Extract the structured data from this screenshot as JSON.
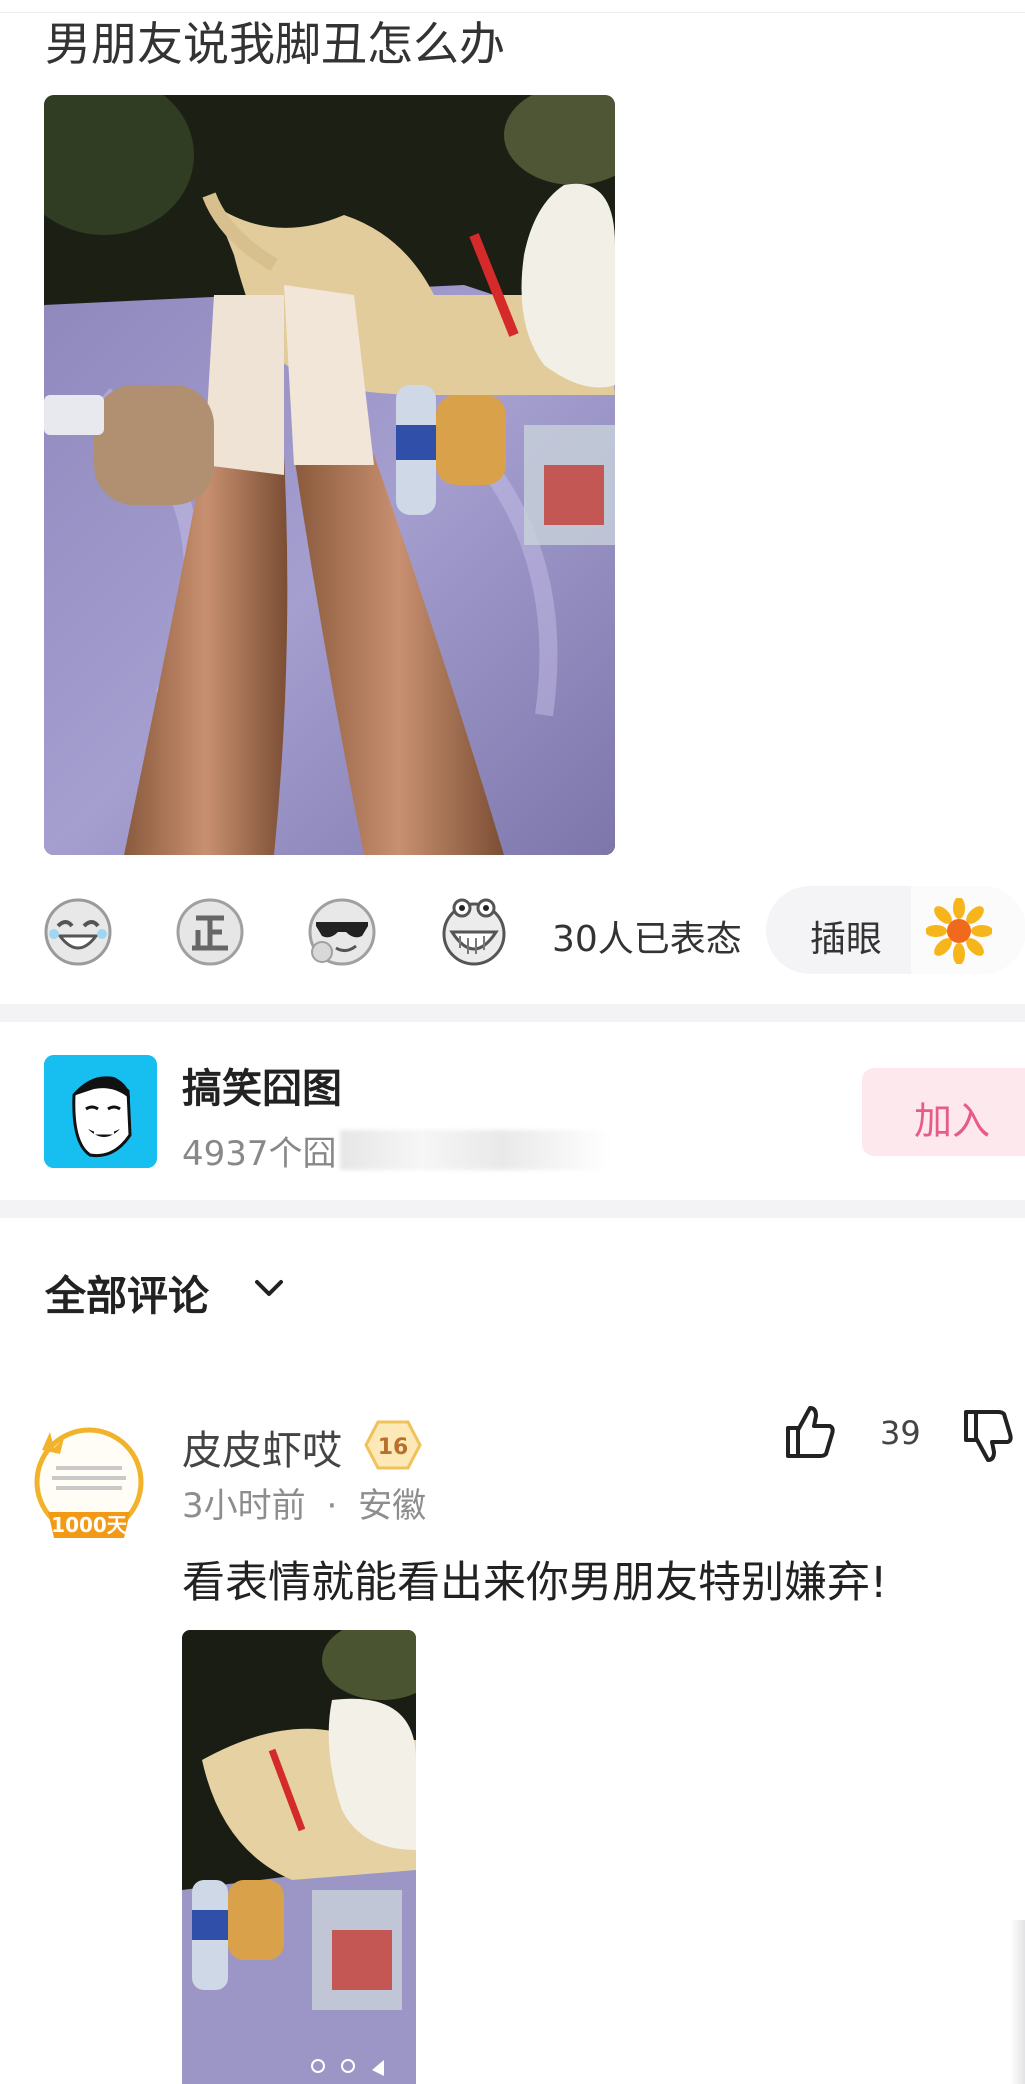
{
  "post": {
    "title": "男朋友说我脚丑怎么办",
    "image_alt": "photo of legs in white socks on a purple picnic blanket next to a cream-colored dog at night"
  },
  "reactions": {
    "emojis": [
      "laughing-emoji-icon",
      "zheng-emoji-icon",
      "sunglasses-emoji-icon",
      "grinning-emoji-icon"
    ],
    "count_text": "30人已表态",
    "pill_label": "插眼",
    "pill_icon": "sunflower-icon"
  },
  "group": {
    "name": "搞笑囧图",
    "subtitle": "4937个囧",
    "join_label": "加入",
    "accent": "#e75c86"
  },
  "comments_section": {
    "title": "全部评论"
  },
  "comment": {
    "author": "皮皮虾哎",
    "level": "16",
    "time": "3小时前",
    "separator": "·",
    "location": "安徽",
    "text": "看表情就能看出来你男朋友特别嫌弃!",
    "likes": "39",
    "badge_text": "1000天"
  }
}
